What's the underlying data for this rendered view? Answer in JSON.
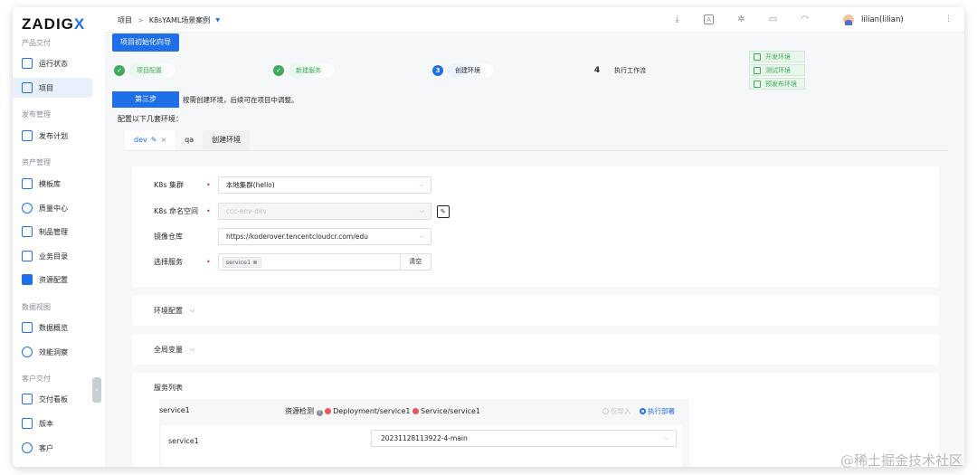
{
  "app": {
    "logo_text": "ZADIGX",
    "accent": "#1f6fe8",
    "success": "#3daa5c"
  },
  "sidebar": {
    "sections": [
      {
        "label": "产品交付"
      },
      {
        "label": "发布管理"
      },
      {
        "label": "资产管理"
      },
      {
        "label": "数据视图"
      },
      {
        "label": "客户交付"
      }
    ],
    "items": [
      {
        "label": "运行状态",
        "icon": "activity-icon"
      },
      {
        "label": "项目",
        "icon": "project-icon",
        "active": true
      },
      {
        "label": "发布计划",
        "icon": "release-plan-icon"
      },
      {
        "label": "模板库",
        "icon": "template-icon"
      },
      {
        "label": "质量中心",
        "icon": "quality-icon"
      },
      {
        "label": "制品管理",
        "icon": "artifact-icon"
      },
      {
        "label": "业务目录",
        "icon": "catalog-icon"
      },
      {
        "label": "资源配置",
        "icon": "resource-icon"
      },
      {
        "label": "数据概览",
        "icon": "data-overview-icon"
      },
      {
        "label": "效能洞察",
        "icon": "insight-icon"
      },
      {
        "label": "交付看板",
        "icon": "board-icon"
      },
      {
        "label": "版本",
        "icon": "version-icon"
      },
      {
        "label": "客户",
        "icon": "customer-icon"
      }
    ],
    "collapse_glyph": "‹"
  },
  "topbar": {
    "breadcrumb": {
      "root": "项目",
      "sep": ">",
      "current": "K8sYAML场景案例",
      "caret": "▼"
    },
    "user": "lilian(lilian)",
    "icons": [
      "download-icon",
      "translate-icon",
      "ai-icon",
      "docs-icon",
      "bell-icon"
    ],
    "more": "⋮"
  },
  "wizard": {
    "title_button": "项目初始化向导",
    "steps": [
      {
        "num": "✓",
        "label": "项目配置",
        "state": "done"
      },
      {
        "num": "✓",
        "label": "新建服务",
        "state": "done"
      },
      {
        "num": "3",
        "label": "创建环境",
        "state": "current"
      },
      {
        "num": "4",
        "label": "执行工作流",
        "state": "todo"
      }
    ],
    "env_tags": [
      "开发环境",
      "测试环境",
      "预发布环境"
    ],
    "step_badge": "第三步",
    "hint": "按需创建环境，后续可在项目中调整。",
    "config_label": "配置以下几套环境："
  },
  "env_tabs": {
    "dev": "dev",
    "dev_edit": "✎",
    "dev_close": "×",
    "qa": "qa",
    "create": "创建环境"
  },
  "form": {
    "cluster_label": "K8s 集群",
    "cluster_value": "本地集群(hello)",
    "namespace_label": "K8s 命名空间",
    "namespace_value": "ccc-env-dev",
    "registry_label": "镜像仓库",
    "registry_value": "https://koderover.tencentcloudcr.com/edu",
    "service_label": "选择服务",
    "service_chip": "service1",
    "clear_label": "清空",
    "required_mark": "•",
    "chevron": "⌵"
  },
  "collapsibles": {
    "env_config": "环境配置",
    "global_vars": "全局变量",
    "chev": "⌵"
  },
  "service_list": {
    "title": "服务列表",
    "row_name": "service1",
    "check_label": "资源检测",
    "info": "?",
    "check_items": [
      "Deployment/service1",
      "Service/service1"
    ],
    "import_only": "仅导入",
    "execute_deploy": "执行部署",
    "inner_name": "service1",
    "inner_tag": "20231128113922-4-main"
  },
  "watermark": "@稀土掘金技术社区"
}
